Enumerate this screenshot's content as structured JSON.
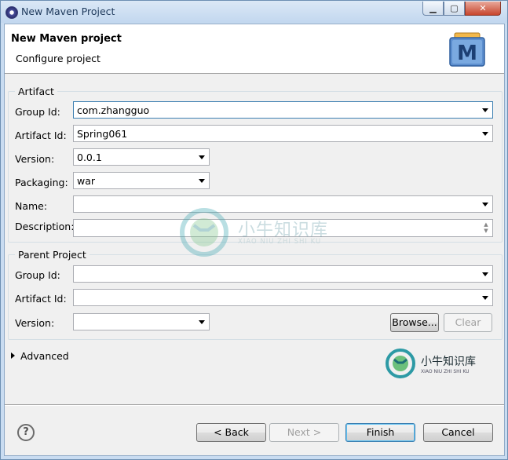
{
  "window": {
    "title": "New Maven Project",
    "minimize": "▁",
    "maximize": "▢",
    "close": "✕"
  },
  "header": {
    "title": "New Maven project",
    "subtitle": "Configure project",
    "logo_letter": "M"
  },
  "artifact": {
    "legend": "Artifact",
    "group_id": {
      "label": "Group Id:",
      "value": "com.zhangguo"
    },
    "artifact_id": {
      "label": "Artifact Id:",
      "value": "Spring061"
    },
    "version": {
      "label": "Version:",
      "value": "0.0.1"
    },
    "packaging": {
      "label": "Packaging:",
      "value": "war"
    },
    "name": {
      "label": "Name:",
      "value": ""
    },
    "description": {
      "label": "Description:",
      "value": ""
    }
  },
  "parent": {
    "legend": "Parent Project",
    "group_id": {
      "label": "Group Id:",
      "value": ""
    },
    "artifact_id": {
      "label": "Artifact Id:",
      "value": ""
    },
    "version": {
      "label": "Version:",
      "value": ""
    },
    "browse_label": "Browse...",
    "clear_label": "Clear"
  },
  "advanced": {
    "label": "Advanced"
  },
  "watermark": {
    "text": "小牛知识库",
    "subtext": "XIAO NIU ZHI SHI KU"
  },
  "footer": {
    "help": "?",
    "back": "< Back",
    "next": "Next >",
    "finish": "Finish",
    "cancel": "Cancel"
  },
  "colors": {
    "maven_blue": "#2f5f9e",
    "watermark_teal": "#3aa6b0",
    "focus_blue": "#3c7fb1"
  }
}
